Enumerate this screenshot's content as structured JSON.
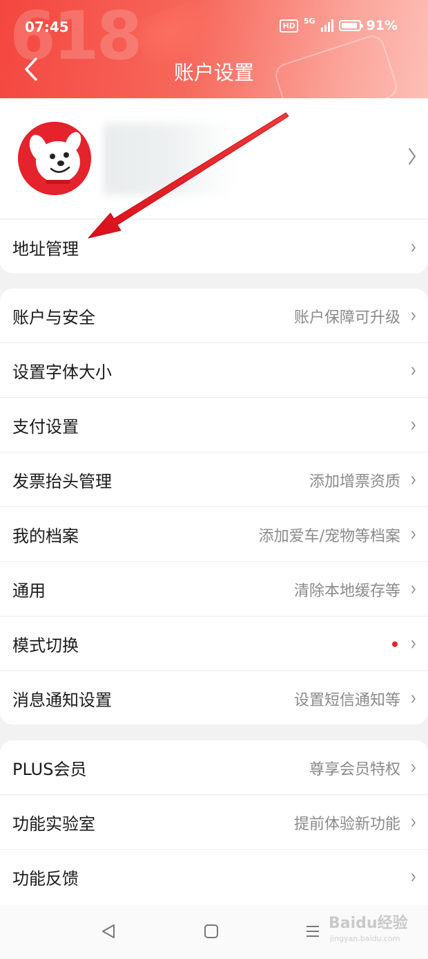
{
  "status_bar": {
    "time": "07:45",
    "hd": "HD",
    "network": "5G",
    "battery": "91%"
  },
  "header": {
    "title": "账户设置",
    "decoration_text": "618"
  },
  "menu_address": {
    "label": "地址管理"
  },
  "group_main": [
    {
      "label": "账户与安全",
      "value": "账户保障可升级"
    },
    {
      "label": "设置字体大小",
      "value": ""
    },
    {
      "label": "支付设置",
      "value": ""
    },
    {
      "label": "发票抬头管理",
      "value": "添加增票资质"
    },
    {
      "label": "我的档案",
      "value": "添加爱车/宠物等档案"
    },
    {
      "label": "通用",
      "value": "清除本地缓存等"
    },
    {
      "label": "模式切换",
      "value": ""
    },
    {
      "label": "消息通知设置",
      "value": "设置短信通知等"
    }
  ],
  "group_extra": [
    {
      "label": "PLUS会员",
      "value": "尊享会员特权"
    },
    {
      "label": "功能实验室",
      "value": "提前体验新功能"
    },
    {
      "label": "功能反馈",
      "value": ""
    }
  ],
  "watermark": {
    "brand": "Baidu经验",
    "url": "jingyan.baidu.com"
  },
  "colors": {
    "brand_red": "#e4232d",
    "header_gradient_start": "#f4463f",
    "annotation_arrow": "#e0141c"
  },
  "icons": [
    "back-arrow-icon",
    "chevron-right-icon",
    "signal-icon",
    "battery-icon",
    "nav-back-icon",
    "nav-home-icon",
    "nav-menu-icon"
  ]
}
